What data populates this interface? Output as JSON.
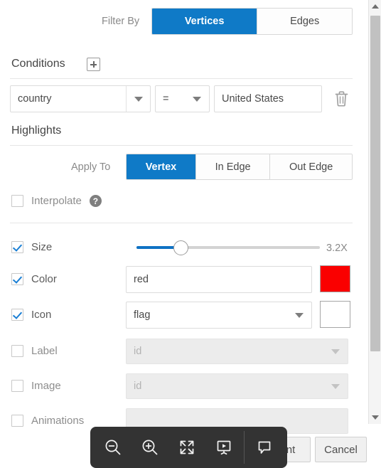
{
  "filter": {
    "label": "Filter By",
    "tabs": [
      {
        "label": "Vertices",
        "active": true
      },
      {
        "label": "Edges",
        "active": false
      }
    ]
  },
  "conditions": {
    "title": "Conditions",
    "add_icon": "plus-icon",
    "rows": [
      {
        "field": "country",
        "operator": "=",
        "value": "United States",
        "delete_icon": "trash-icon"
      }
    ]
  },
  "highlights": {
    "title": "Highlights",
    "apply_to": {
      "label": "Apply To",
      "tabs": [
        {
          "label": "Vertex",
          "active": true
        },
        {
          "label": "In Edge",
          "active": false
        },
        {
          "label": "Out Edge",
          "active": false
        }
      ]
    },
    "interpolate": {
      "label": "Interpolate",
      "checked": false,
      "help_icon": "help-circle-icon",
      "help_glyph": "?"
    },
    "rows": [
      {
        "label": "Size",
        "checked": true,
        "control": "slider",
        "slider_value": "3.2X",
        "slider_percent": 24
      },
      {
        "label": "Color",
        "checked": true,
        "control": "text",
        "value": "red",
        "swatch": "#fa0000"
      },
      {
        "label": "Icon",
        "checked": true,
        "control": "select",
        "value": "flag",
        "swatch": "#ffffff"
      },
      {
        "label": "Label",
        "checked": false,
        "control": "select-disabled",
        "value": "id"
      },
      {
        "label": "Image",
        "checked": false,
        "control": "select-disabled",
        "value": "id"
      },
      {
        "label": "Animations",
        "checked": false,
        "control": "select-disabled",
        "value": ""
      }
    ]
  },
  "toolbar": {
    "buttons": [
      {
        "icon": "zoom-out-icon"
      },
      {
        "icon": "zoom-in-icon"
      },
      {
        "icon": "fullscreen-icon"
      },
      {
        "icon": "presentation-icon"
      },
      {
        "icon": "comment-icon"
      }
    ]
  },
  "footer": {
    "primary_label": "nt",
    "cancel_label": "Cancel"
  },
  "scrollbar": {
    "up_icon": "chevron-up-icon",
    "down_icon": "chevron-down-icon"
  },
  "colors": {
    "accent": "#0f7ac7",
    "swatch_red": "#fa0000",
    "toolbar_bg": "#333333"
  }
}
